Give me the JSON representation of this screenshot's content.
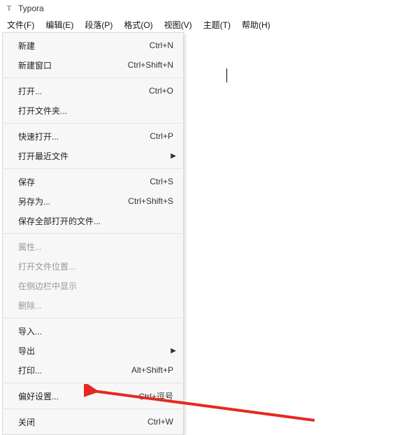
{
  "title": "Typora",
  "menubar": [
    {
      "key": "file",
      "label": "文件(F)"
    },
    {
      "key": "edit",
      "label": "编辑(E)"
    },
    {
      "key": "para",
      "label": "段落(P)"
    },
    {
      "key": "format",
      "label": "格式(O)"
    },
    {
      "key": "view",
      "label": "视图(V)"
    },
    {
      "key": "theme",
      "label": "主题(T)"
    },
    {
      "key": "help",
      "label": "帮助(H)"
    }
  ],
  "fileMenu": {
    "new": {
      "label": "新建",
      "shortcut": "Ctrl+N"
    },
    "newWindow": {
      "label": "新建窗口",
      "shortcut": "Ctrl+Shift+N"
    },
    "open": {
      "label": "打开...",
      "shortcut": "Ctrl+O"
    },
    "openFolder": {
      "label": "打开文件夹...",
      "shortcut": ""
    },
    "quickOpen": {
      "label": "快速打开...",
      "shortcut": "Ctrl+P"
    },
    "openRecent": {
      "label": "打开最近文件",
      "shortcut": "",
      "submenu": true
    },
    "save": {
      "label": "保存",
      "shortcut": "Ctrl+S"
    },
    "saveAs": {
      "label": "另存为...",
      "shortcut": "Ctrl+Shift+S"
    },
    "saveAll": {
      "label": "保存全部打开的文件...",
      "shortcut": ""
    },
    "properties": {
      "label": "属性...",
      "shortcut": "",
      "disabled": true
    },
    "openLocation": {
      "label": "打开文件位置...",
      "shortcut": "",
      "disabled": true
    },
    "revealSidebar": {
      "label": "在侧边栏中显示",
      "shortcut": "",
      "disabled": true
    },
    "delete": {
      "label": "删除...",
      "shortcut": "",
      "disabled": true
    },
    "import": {
      "label": "导入...",
      "shortcut": ""
    },
    "export": {
      "label": "导出",
      "shortcut": "",
      "submenu": true
    },
    "print": {
      "label": "打印...",
      "shortcut": "Alt+Shift+P"
    },
    "preferences": {
      "label": "偏好设置...",
      "shortcut": "Ctrl+逗号"
    },
    "close": {
      "label": "关闭",
      "shortcut": "Ctrl+W"
    }
  }
}
